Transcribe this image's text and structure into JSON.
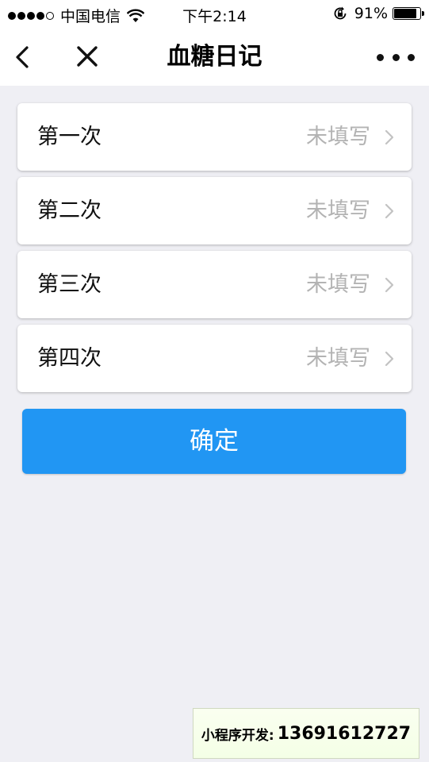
{
  "status_bar": {
    "carrier": "中国电信",
    "time": "下午2:14",
    "battery_percent": "91%",
    "battery_level": 0.91,
    "signal_icons": [
      "signal-dots-icon",
      "wifi-icon",
      "rotation-lock-icon",
      "battery-icon"
    ]
  },
  "nav": {
    "title": "血糖日记",
    "icons": [
      "back-icon",
      "close-icon",
      "more-icon"
    ]
  },
  "entries": [
    {
      "label": "第一次",
      "status": "未填写"
    },
    {
      "label": "第二次",
      "status": "未填写"
    },
    {
      "label": "第三次",
      "status": "未填写"
    },
    {
      "label": "第四次",
      "status": "未填写"
    }
  ],
  "confirm_label": "确定",
  "watermark": {
    "label": "小程序开发:",
    "number": "13691612727"
  },
  "colors": {
    "primary": "#2196f3",
    "background": "#efeff4",
    "placeholder_text": "#b3b3b3"
  }
}
